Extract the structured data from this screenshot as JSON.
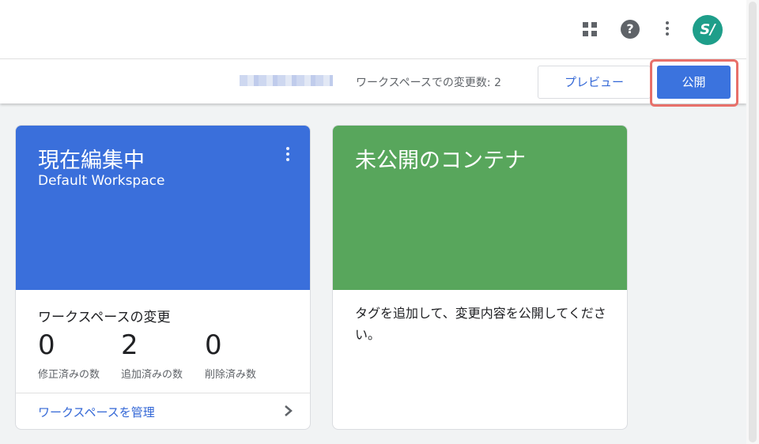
{
  "header": {
    "help_icon_glyph": "?",
    "avatar_initials": "S/"
  },
  "toolbar": {
    "changes_count_text": "ワークスペースでの変更数: 2",
    "preview_label": "プレビュー",
    "publish_label": "公開",
    "publish_color": "#3b73de",
    "highlight_color": "#e8706a"
  },
  "workspace_card": {
    "title": "現在編集中",
    "subtitle": "Default Workspace",
    "header_color": "#3a6fdb",
    "changes_label": "ワークスペースの変更",
    "stats": [
      {
        "value": "0",
        "label": "修正済みの数"
      },
      {
        "value": "2",
        "label": "追加済みの数"
      },
      {
        "value": "0",
        "label": "削除済み数"
      }
    ],
    "manage_link": "ワークスペースを管理"
  },
  "unpublished_card": {
    "title": "未公開のコンテナ",
    "header_color": "#58a65c",
    "body_text": "タグを追加して、変更内容を公開してください。"
  }
}
